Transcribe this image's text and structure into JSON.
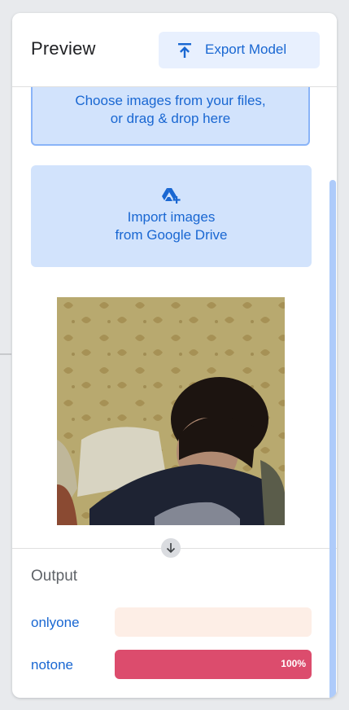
{
  "header": {
    "title": "Preview",
    "export_label": "Export Model"
  },
  "upload": {
    "line1": "Choose images from your files,",
    "line2": "or drag & drop here"
  },
  "drive": {
    "line1": "Import images",
    "line2": "from Google Drive"
  },
  "output": {
    "title": "Output",
    "classes": [
      {
        "label": "onlyone",
        "confidence": 0.0,
        "percent_text": ""
      },
      {
        "label": "notone",
        "confidence": 1.0,
        "percent_text": "100%"
      }
    ]
  },
  "colors": {
    "accent": "#1967d2",
    "bar_fill": "#dc4c6d",
    "bar_track": "#fdeee6",
    "button_bg": "#e8f0fe",
    "upload_bg": "#d2e3fc"
  },
  "icons": {
    "export": "upload-arrow-icon",
    "drive": "google-drive-add-icon",
    "down": "arrow-down-icon"
  }
}
